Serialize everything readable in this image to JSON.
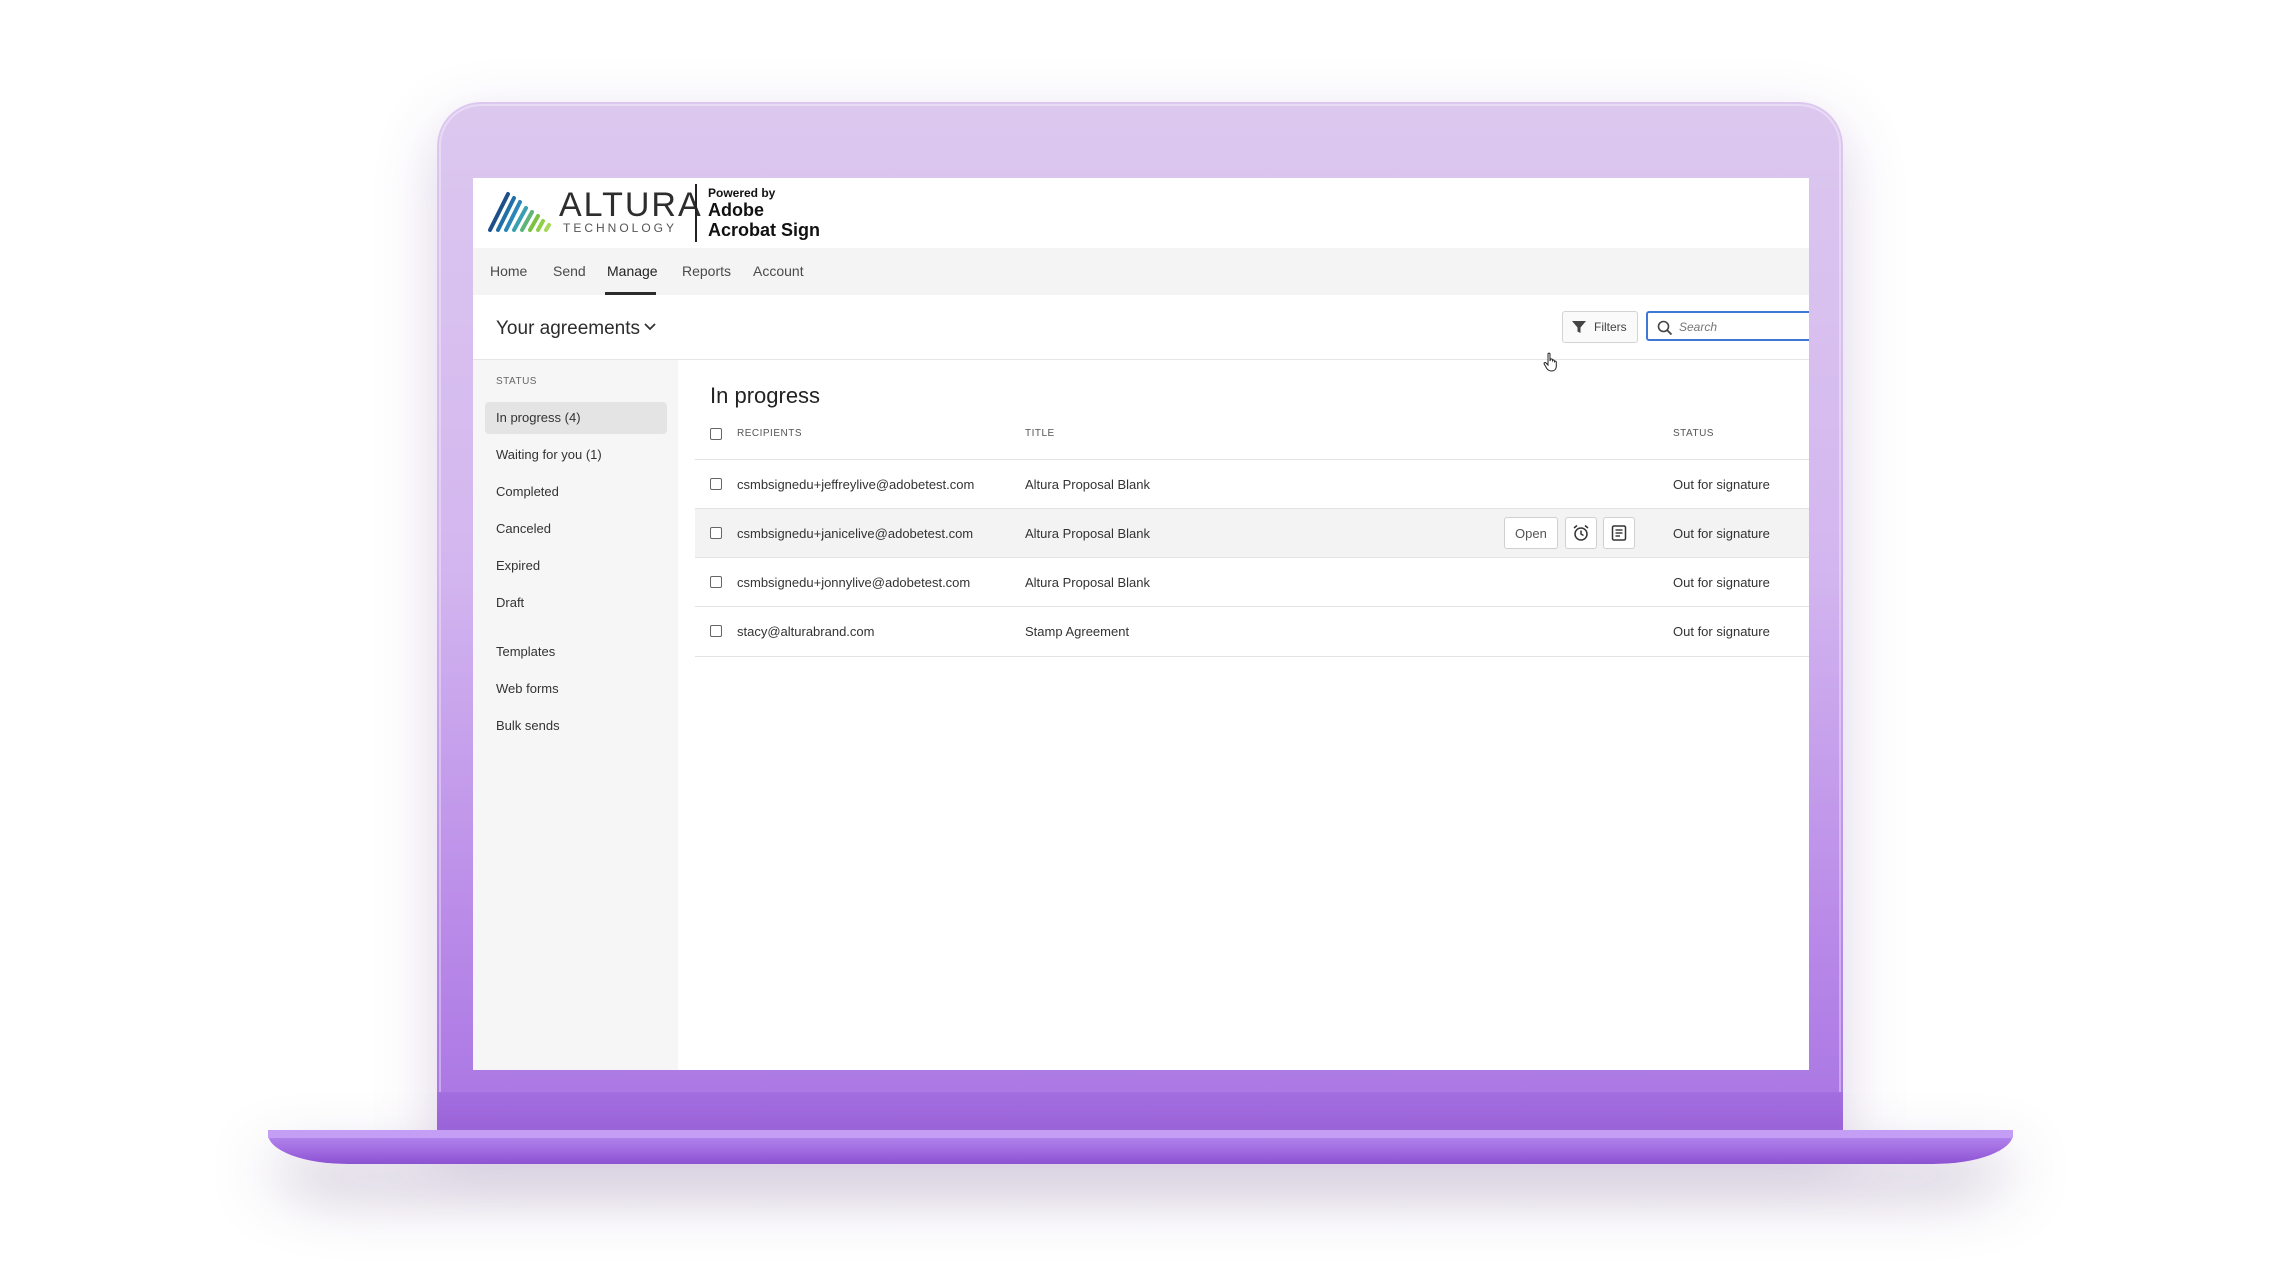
{
  "brand": {
    "logo_word": "ALTURA",
    "logo_sub": "TECHNOLOGY",
    "powered_by": "Powered by",
    "product_line1": "Adobe",
    "product_line2": "Acrobat Sign"
  },
  "nav": {
    "items": [
      "Home",
      "Send",
      "Manage",
      "Reports",
      "Account"
    ],
    "active": "Manage"
  },
  "header": {
    "title": "Your agreements",
    "filters_label": "Filters",
    "search_placeholder": "Search"
  },
  "sidebar": {
    "heading": "STATUS",
    "status_items": [
      "In progress (4)",
      "Waiting for you (1)",
      "Completed",
      "Canceled",
      "Expired",
      "Draft"
    ],
    "other_items": [
      "Templates",
      "Web forms",
      "Bulk sends"
    ]
  },
  "main": {
    "title": "In progress",
    "columns": {
      "recipients": "RECIPIENTS",
      "title": "TITLE",
      "status": "STATUS"
    },
    "rows": [
      {
        "recipient": "csmbsignedu+jeffreylive@adobetest.com",
        "title": "Altura Proposal Blank",
        "status": "Out for signature"
      },
      {
        "recipient": "csmbsignedu+janicelive@adobetest.com",
        "title": "Altura Proposal Blank",
        "status": "Out for signature"
      },
      {
        "recipient": "csmbsignedu+jonnylive@adobetest.com",
        "title": "Altura Proposal Blank",
        "status": "Out for signature"
      },
      {
        "recipient": "stacy@alturabrand.com",
        "title": "Stamp Agreement",
        "status": "Out for signature"
      }
    ],
    "row_actions": {
      "open_label": "Open",
      "reminder_icon": "alarm-clock-icon",
      "history_icon": "document-notes-icon"
    }
  },
  "colors": {
    "laptop_purple": "#b98ae8",
    "search_border": "#3f78d4",
    "logo_blue": "#1f6fa8",
    "logo_green": "#7cc242"
  }
}
